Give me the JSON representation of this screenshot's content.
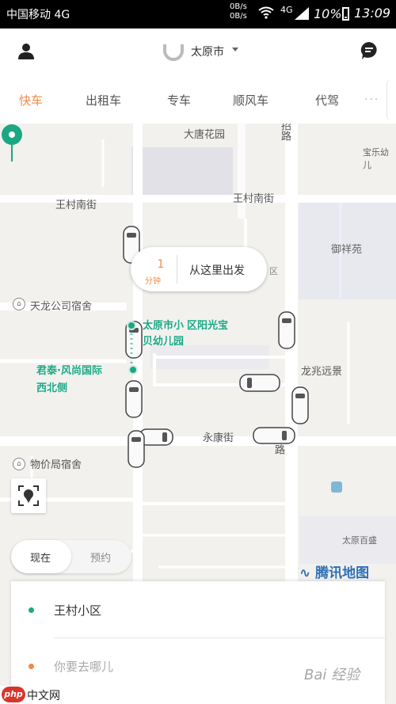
{
  "status_bar": {
    "carrier": "中国移动 4G",
    "upload_speed": "0B/s",
    "download_speed": "0B/s",
    "network": "4G",
    "battery": "10%",
    "time": "13:09"
  },
  "header": {
    "city": "太原市"
  },
  "tabs": [
    {
      "label": "快车",
      "active": true
    },
    {
      "label": "出租车",
      "active": false
    },
    {
      "label": "专车",
      "active": false
    },
    {
      "label": "顺风车",
      "active": false
    },
    {
      "label": "代驾",
      "active": false
    }
  ],
  "tabs_more": "···",
  "map": {
    "labels": {
      "datang_garden": "大唐花园",
      "wangcun_south": "王村南街",
      "wangcun_south_2": "王村南街",
      "zhao_road": "招路",
      "yuxiang_garden": "御祥苑",
      "anle_kindergarten": "宝乐幼儿",
      "tianlong_dorm": "天龙公司宿舍",
      "longzhao_yuanjing": "龙兆远景",
      "yongkang_street": "永康街",
      "wujiaju_dorm": "物价局宿舍",
      "hospital_fragment": "区",
      "dayuan_fragment": "太原百盛",
      "wm_road": "路"
    },
    "poi_green_1": "太原市小区阳光宝贝幼儿园",
    "poi_green_1a": "太原市小",
    "poi_green_1b": "区阳光宝",
    "poi_green_1c": "贝幼儿园",
    "poi_green_2a": "君泰·风尚国际",
    "poi_green_2b": "西北侧",
    "provider": "腾讯地图"
  },
  "bubble": {
    "eta_value": "1",
    "eta_unit": "分钟",
    "action": "从这里出发"
  },
  "time_toggle": {
    "now": "现在",
    "reserve": "预约"
  },
  "trip_card": {
    "origin": "王村小区",
    "destination_placeholder": "你要去哪儿"
  },
  "colors": {
    "accent_orange": "#f08a48",
    "accent_green": "#1ba784",
    "tencent_blue": "#2f6fb5"
  },
  "watermarks": {
    "baidu": "Bai 经验",
    "php": "php",
    "cn": "中文网"
  }
}
